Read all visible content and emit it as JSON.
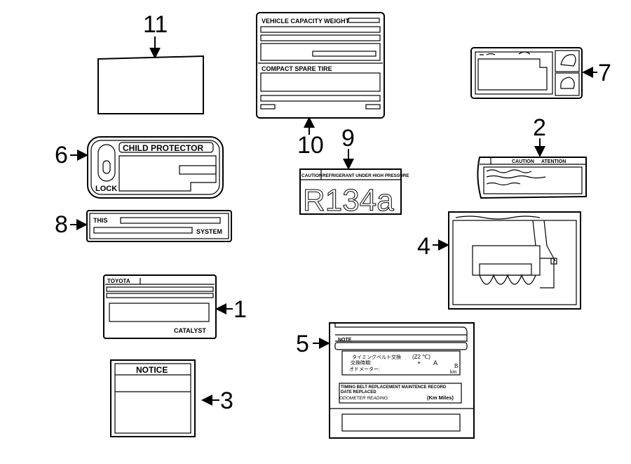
{
  "callouts": {
    "n1": "1",
    "n2": "2",
    "n3": "3",
    "n4": "4",
    "n5": "5",
    "n6": "6",
    "n7": "7",
    "n8": "8",
    "n9": "9",
    "n10": "10",
    "n11": "11"
  },
  "label10": {
    "title": "VEHICLE CAPACITY WEIGHT",
    "spare": "COMPACT  SPARE  TIRE"
  },
  "label6": {
    "title": "CHILD  PROTECTOR",
    "lock": "LOCK"
  },
  "label8": {
    "this": "THIS",
    "system": "SYSTEM"
  },
  "label9": {
    "caution": "CAUTION",
    "warning": "REFRIGERANT UNDER HIGH PRESSURE",
    "refrigerant": "R134a"
  },
  "label2": {
    "caution": "CAUTION",
    "atention": "ATENTION"
  },
  "label1": {
    "brand": "TOYOTA",
    "catalyst": "CATALYST"
  },
  "label3": {
    "title": "NOTICE"
  },
  "label5": {
    "note": "NOTE",
    "jp1": "タイミングベルト交換",
    "jp2": "交換時期:",
    "jp3": "オドメーター:",
    "z": "(Z2 ℃)",
    "plus": "+",
    "a": "A",
    "b": "B",
    "km": "km",
    "record": "TIMING BELT REPLACEMENT MAINTENCE RECORD",
    "date": "DATE REPLACED",
    "odometer": "ODOMETER READING:",
    "units": "(Km   Miles)"
  }
}
